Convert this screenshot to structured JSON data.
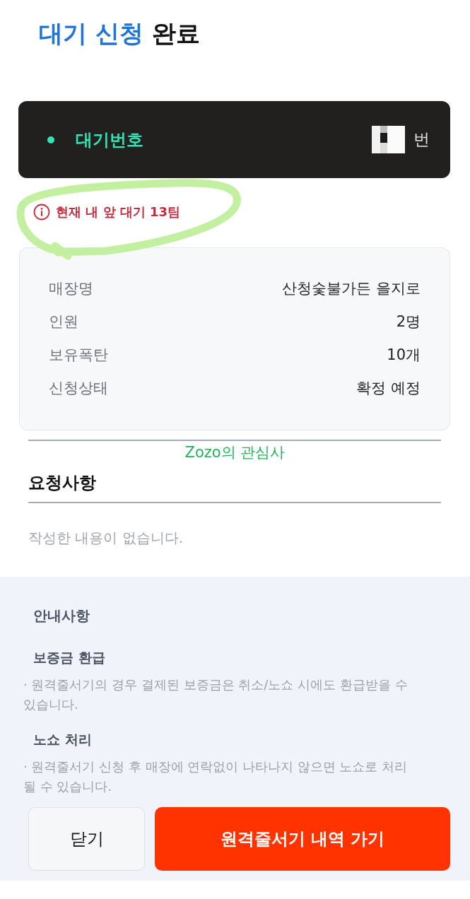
{
  "title": {
    "highlight": "대기 신청",
    "rest": "완료"
  },
  "waiting_card": {
    "label": "대기번호",
    "unit": "번"
  },
  "notice": {
    "text": "현재 내 앞 대기 13팀"
  },
  "details": [
    {
      "label": "매장명",
      "value": "산청숯불가든 을지로"
    },
    {
      "label": "인원",
      "value": "2명"
    },
    {
      "label": "보유폭탄",
      "value": "10개"
    },
    {
      "label": "신청상태",
      "value": "확정 예정"
    }
  ],
  "overlay_caption": "Zozo의 관심사",
  "request": {
    "heading": "요청사항",
    "empty_text": "작성한 내용이 없습니다."
  },
  "guide": {
    "heading": "안내사항",
    "sections": [
      {
        "title": "보증금 환급",
        "items": [
          "· 원격줄서기의 경우 결제된 보증금은 취소/노쇼 시에도 환급받을 수 있습니다."
        ]
      },
      {
        "title": "노쇼 처리",
        "items": [
          "· 원격줄서기 신청 후 매장에 연락없이 나타나지 않으면 노쇼로 처리될 수 있습니다."
        ]
      }
    ]
  },
  "buttons": [
    {
      "label": "닫기",
      "kind": "secondary"
    },
    {
      "label": "원격줄서기 내역 가기",
      "kind": "primary"
    }
  ]
}
